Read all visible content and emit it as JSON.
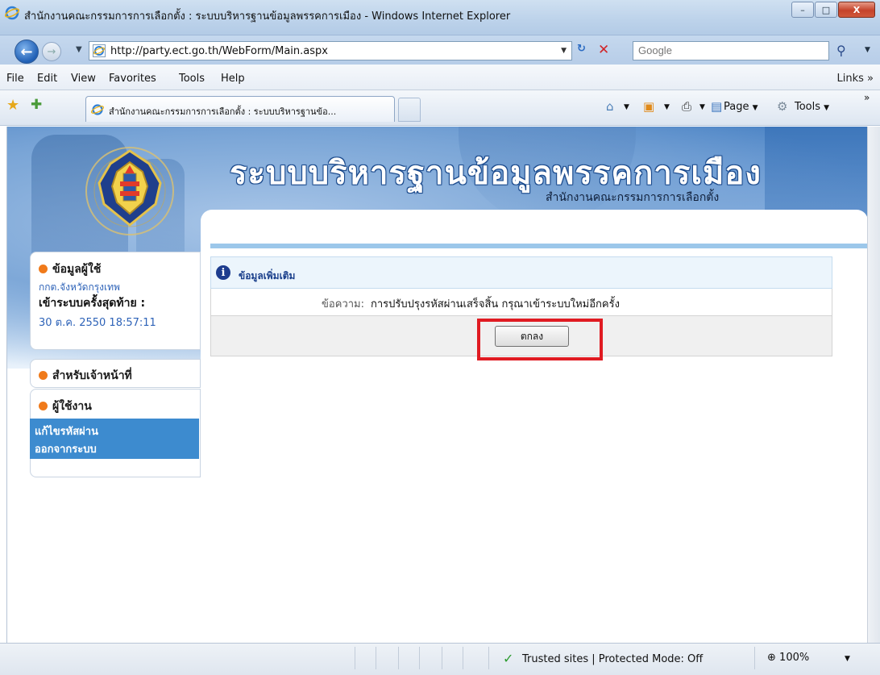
{
  "window": {
    "title": "สำนักงานคณะกรรมการการเลือกตั้ง : ระบบบริหารฐานข้อมูลพรรคการเมือง - Windows Internet Explorer",
    "minimize": "–",
    "maximize": "□",
    "close": "X"
  },
  "address": {
    "url": "http://party.ect.go.th/WebForm/Main.aspx",
    "search_placeholder": "Google"
  },
  "menu": {
    "file": "File",
    "edit": "Edit",
    "view": "View",
    "favorites": "Favorites",
    "tools": "Tools",
    "help": "Help",
    "links": "Links"
  },
  "tab": {
    "title": "สำนักงานคณะกรรมการการเลือกตั้ง : ระบบบริหารฐานข้อ..."
  },
  "command_bar": {
    "page": "Page",
    "tools": "Tools"
  },
  "banner": {
    "title": "ระบบบริหารฐานข้อมูลพรรคการเมือง",
    "subtitle": "สำนักงานคณะกรรมการการเลือกตั้ง"
  },
  "sidebar": {
    "user_info_heading": "ข้อมูลผู้ใช้",
    "province": "กกต.จังหวัดกรุงเทพ",
    "last_login_label": "เข้าระบบครั้งสุดท้าย :",
    "last_login_time": "30 ต.ค. 2550 18:57:11",
    "staff_heading": "สำหรับเจ้าหน้าที่",
    "user_heading": "ผู้ใช้งาน",
    "menu_items": [
      {
        "label": "แก้ไขรหัสผ่าน"
      },
      {
        "label": "ออกจากระบบ"
      }
    ]
  },
  "main": {
    "info_title": "ข้อมูลเพิ่มเติม",
    "message_label": "ข้อความ:",
    "message_text": "การปรับปรุงรหัสผ่านเสร็จสิ้น กรุณาเข้าระบบใหม่อีกครั้ง",
    "ok_button": "ตกลง"
  },
  "status": {
    "zone": "Trusted sites | Protected Mode: Off",
    "zoom": "100%"
  },
  "colors": {
    "highlight_border": "#e01b22",
    "sidebar_menu_bg": "#3d8bcf",
    "sidebar_bullet": "#f07a1a",
    "info_link": "#1a3f8b"
  }
}
